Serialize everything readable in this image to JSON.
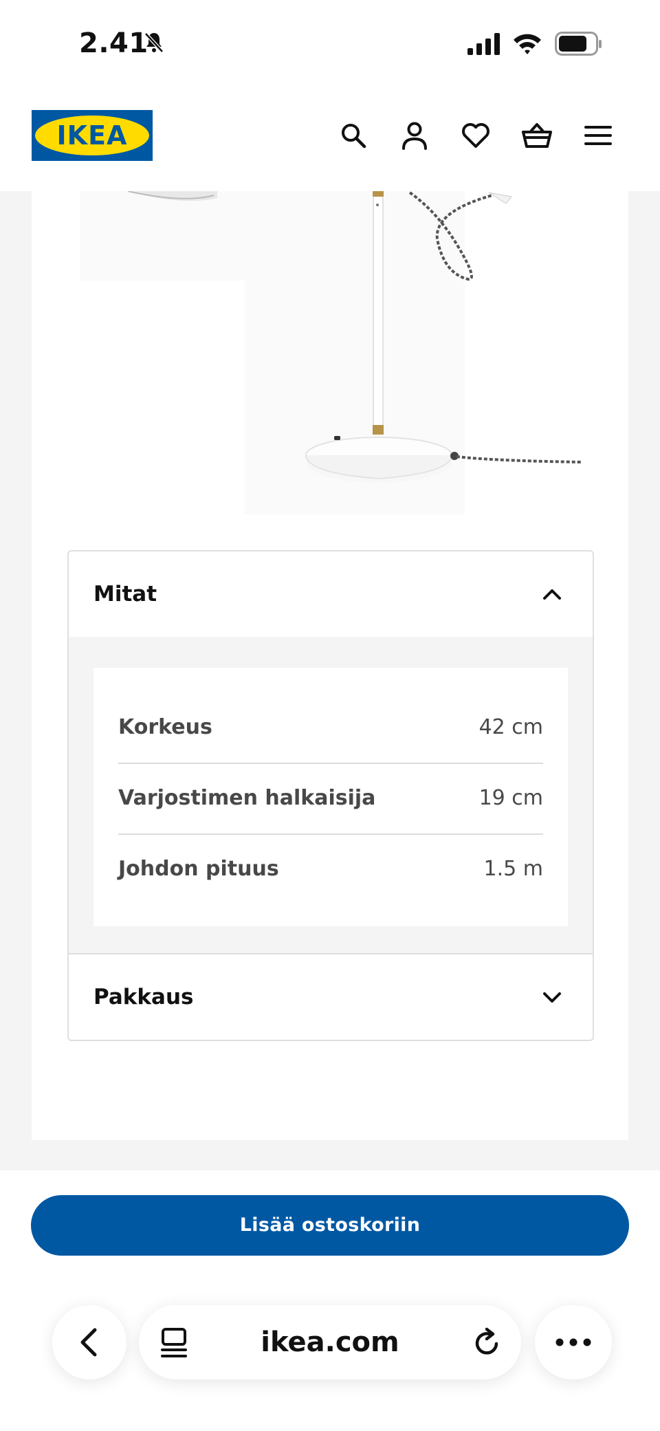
{
  "status_bar": {
    "time": "2.41"
  },
  "header": {
    "logo_text": "IKEA",
    "icons": [
      "search-icon",
      "account-icon",
      "heart-icon",
      "basket-icon",
      "menu-icon"
    ],
    "brand_blue": "#0058a3",
    "brand_yellow": "#ffdb00"
  },
  "dimensions": {
    "title": "Mitat",
    "rows": [
      {
        "label": "Korkeus",
        "value": "42 cm"
      },
      {
        "label": "Varjostimen halkaisija",
        "value": "19 cm"
      },
      {
        "label": "Johdon pituus",
        "value": "1.5 m"
      }
    ]
  },
  "packaging": {
    "title": "Pakkaus"
  },
  "cart_button": {
    "label": "Lisää ostoskoriin"
  },
  "browser": {
    "url": "ikea.com"
  }
}
